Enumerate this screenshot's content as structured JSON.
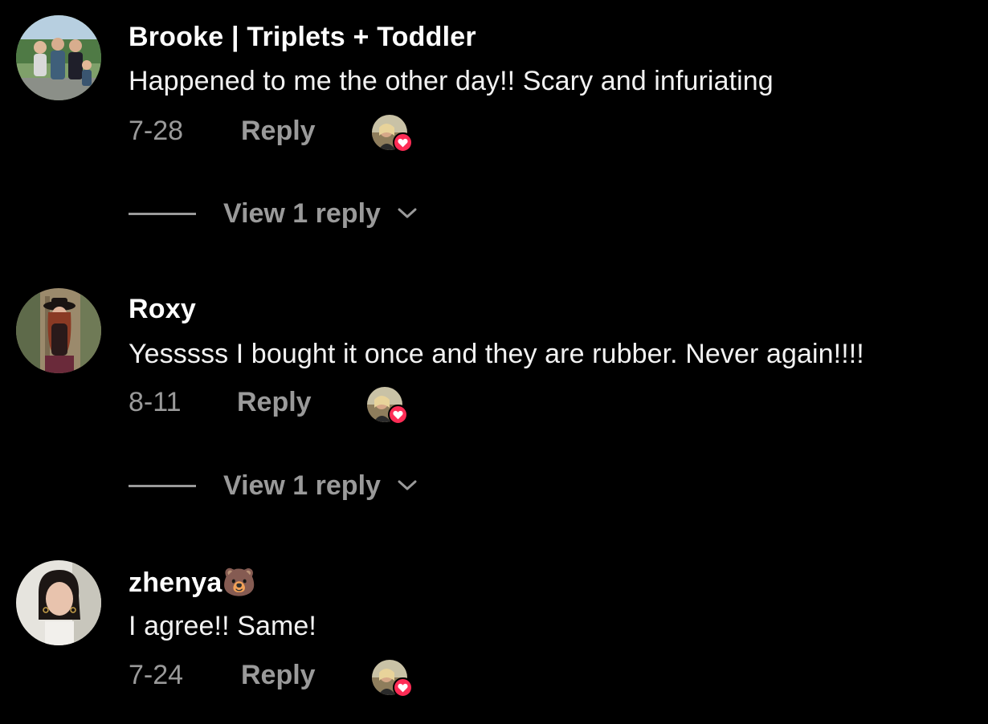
{
  "comments": [
    {
      "username": "Brooke | Triplets + Toddler",
      "text": "Happened to me the other day!! Scary and infuriating",
      "date": "7-28",
      "reply_label": "Reply",
      "view_replies_label": "View 1 reply"
    },
    {
      "username": "Roxy",
      "text": "Yesssss I bought it once and they are rubber. Never again!!!!",
      "date": "8-11",
      "reply_label": "Reply",
      "view_replies_label": "View 1 reply"
    },
    {
      "username": "zhenya🐻",
      "text": "I agree!! Same!",
      "date": "7-24",
      "reply_label": "Reply"
    }
  ],
  "colors": {
    "background": "#000000",
    "primary_text": "#ffffff",
    "secondary_text": "#9a9a9a",
    "like_badge": "#fe2c55"
  },
  "icons": {
    "creator_liked": "creator-liked-heart-icon",
    "expand": "chevron-down-icon"
  }
}
